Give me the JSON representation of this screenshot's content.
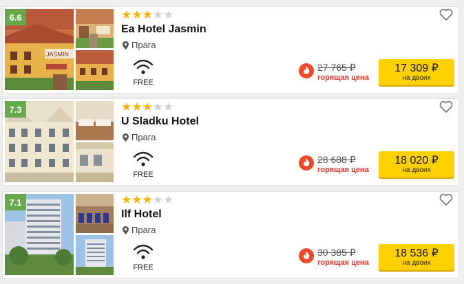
{
  "hotels": [
    {
      "rating": "6.6",
      "stars": 3,
      "stars_total": 5,
      "name": "Ea Hotel Jasmin",
      "location": "Прага",
      "amenity": "FREE",
      "old_price": "27 765 ₽",
      "hot_label": "горящая цена",
      "price": "17 309 ₽",
      "price_sub": "на двоих",
      "sign_text": "JASMIN"
    },
    {
      "rating": "7.3",
      "stars": 3,
      "stars_total": 5,
      "name": "U Sladku Hotel",
      "location": "Прага",
      "amenity": "FREE",
      "old_price": "28 688 ₽",
      "hot_label": "горящая цена",
      "price": "18 020 ₽",
      "price_sub": "на двоих"
    },
    {
      "rating": "7.1",
      "stars": 3,
      "stars_total": 5,
      "name": "Ilf Hotel",
      "location": "Прага",
      "amenity": "FREE",
      "old_price": "30 385 ₽",
      "hot_label": "горящая цена",
      "price": "18 536 ₽",
      "price_sub": "на двоих"
    }
  ],
  "colors": {
    "rating_bg": "#67a84b",
    "star_on": "#f6b000",
    "star_off": "#d0d0d0",
    "button": "#ffd100",
    "hot": "#e8362a"
  },
  "icons": {
    "location": "map-pin-icon",
    "wifi": "wifi-icon",
    "favorite": "heart-icon",
    "hot": "fire-icon"
  }
}
